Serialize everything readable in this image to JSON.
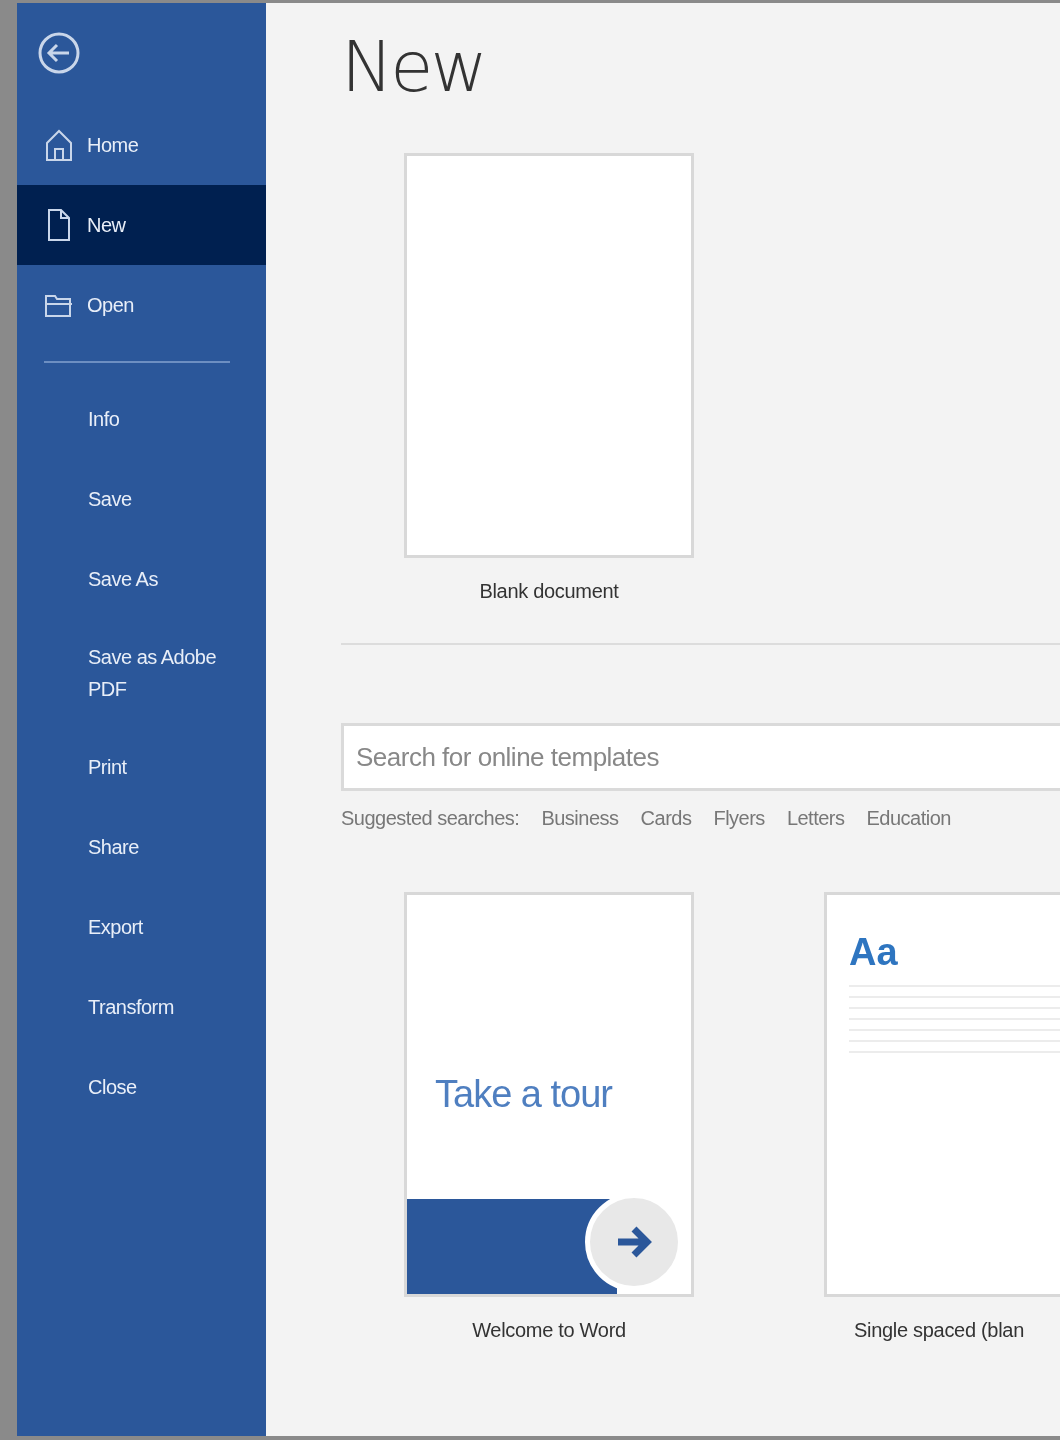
{
  "sidebar": {
    "items": [
      {
        "label": "Home",
        "kind": "home",
        "selected": false
      },
      {
        "label": "New",
        "kind": "new",
        "selected": true
      },
      {
        "label": "Open",
        "kind": "open",
        "selected": false
      },
      {
        "label": "Info",
        "kind": "plain",
        "selected": false
      },
      {
        "label": "Save",
        "kind": "plain",
        "selected": false
      },
      {
        "label": "Save As",
        "kind": "plain",
        "selected": false
      },
      {
        "label": "Save as Adobe PDF",
        "kind": "plain",
        "selected": false
      },
      {
        "label": "Print",
        "kind": "plain",
        "selected": false
      },
      {
        "label": "Share",
        "kind": "plain",
        "selected": false
      },
      {
        "label": "Export",
        "kind": "plain",
        "selected": false
      },
      {
        "label": "Transform",
        "kind": "plain",
        "selected": false
      },
      {
        "label": "Close",
        "kind": "plain",
        "selected": false
      }
    ]
  },
  "page_title": "New",
  "blank": {
    "caption": "Blank document"
  },
  "search": {
    "placeholder": "Search for online templates"
  },
  "suggested": {
    "label": "Suggested searches:",
    "items": [
      "Business",
      "Cards",
      "Flyers",
      "Letters",
      "Education"
    ]
  },
  "templates": [
    {
      "kind": "tour",
      "text": "Take a tour",
      "caption": "Welcome to Word"
    },
    {
      "kind": "styled",
      "text": "Aa",
      "caption": "Single spaced (blan"
    }
  ]
}
